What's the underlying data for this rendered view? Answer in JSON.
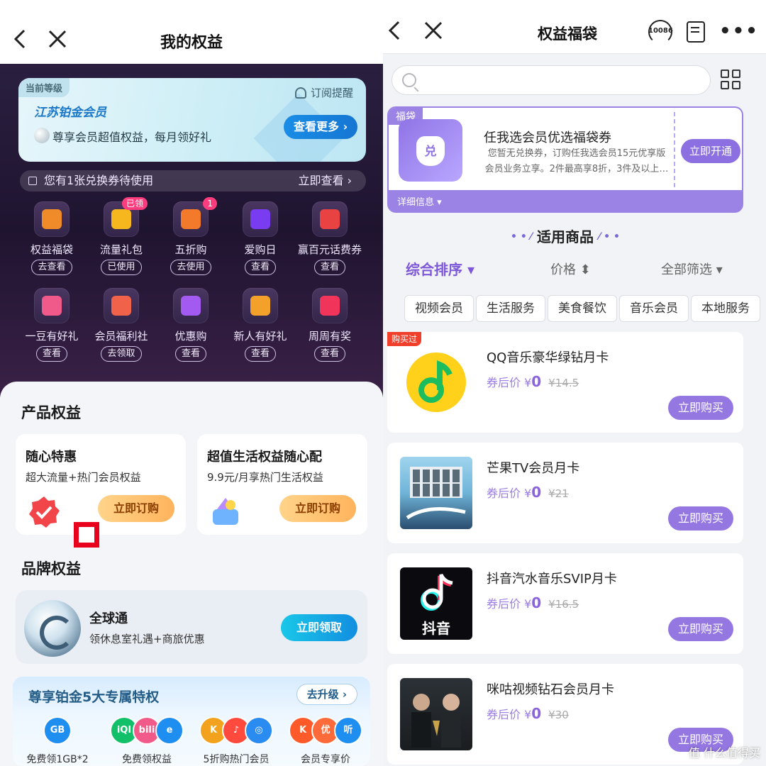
{
  "left": {
    "title": "我的权益",
    "member": {
      "level_tag": "当前等级",
      "subscribe": "订阅提醒",
      "tier": "江苏铂金会员",
      "desc": "尊享会员超值权益，每月领好礼",
      "more": "查看更多 ›"
    },
    "coupon": {
      "text": "您有1张兑换券待使用",
      "action": "立即查看 ›"
    },
    "grid": [
      {
        "label": "权益福袋",
        "action": "去查看",
        "badge": "",
        "color": "#f08b2a"
      },
      {
        "label": "流量礼包",
        "action": "已使用",
        "badge": "已领",
        "color": "#f6b61e"
      },
      {
        "label": "五折购",
        "action": "去使用",
        "badge": "1",
        "color": "#f27a2a"
      },
      {
        "label": "爱购日",
        "action": "查看",
        "badge": "",
        "color": "#7a3cf0"
      },
      {
        "label": "赢百元话费券",
        "action": "查看",
        "badge": "",
        "color": "#e94242"
      },
      {
        "label": "一豆有好礼",
        "action": "查看",
        "badge": "",
        "color": "#f05a8a"
      },
      {
        "label": "会员福利社",
        "action": "去领取",
        "badge": "",
        "color": "#f0634a"
      },
      {
        "label": "优惠购",
        "action": "查看",
        "badge": "",
        "color": "#a35af0"
      },
      {
        "label": "新人有好礼",
        "action": "查看",
        "badge": "",
        "color": "#f3a12a"
      },
      {
        "label": "周周有奖",
        "action": "查看",
        "badge": "",
        "color": "#f0345a"
      }
    ],
    "product_section": "产品权益",
    "products": [
      {
        "title": "随心特惠",
        "desc": "超大流量+热门会员权益",
        "button": "立即订购"
      },
      {
        "title": "超值生活权益随心配",
        "desc": "9.9元/月享热门生活权益",
        "button": "立即订购"
      }
    ],
    "brand_section": "品牌权益",
    "brand": {
      "name": "全球通",
      "desc": "领休息室礼遇+商旅优惠",
      "button": "立即领取"
    },
    "privilege": {
      "title": "尊享铂金5大专属特权",
      "upgrade": "去升级 ›",
      "items": [
        {
          "label": "免费领1GB*2",
          "icons": [
            "GB"
          ]
        },
        {
          "label": "免费领权益",
          "icons": [
            "iQI",
            "bili",
            "e"
          ]
        },
        {
          "label": "5折购热门会员",
          "icons": [
            "K",
            "♪",
            "◎"
          ]
        },
        {
          "label": "会员专享价",
          "icons": [
            "K",
            "优",
            "听"
          ]
        }
      ]
    }
  },
  "right": {
    "title": "权益福袋",
    "service_label": "10086",
    "more": "•••",
    "bag": {
      "tag": "福袋",
      "icon_text": "兑",
      "title": "任我选会员优选福袋券",
      "desc": "您暂无兑换券，订购任我选会员15元优享版会员业务立享。2件最高享8折，3件及以上…",
      "button": "立即开通",
      "info": "详细信息 ▾"
    },
    "section_title": "适用商品",
    "sorts": {
      "overall": "综合排序 ▾",
      "price": "价格 ⬍",
      "filter": "全部筛选 ▾"
    },
    "chips": [
      "视频会员",
      "生活服务",
      "美食餐饮",
      "音乐会员",
      "本地服务"
    ],
    "goods": [
      {
        "name": "QQ音乐豪华绿钻月卡",
        "prefix": "券后价 ¥",
        "price": "0",
        "original": "¥14.5",
        "button": "立即购买",
        "bought": "购买过",
        "logo": "qq"
      },
      {
        "name": "芒果TV会员月卡",
        "prefix": "券后价 ¥",
        "price": "0",
        "original": "¥21",
        "button": "立即购买",
        "bought": "",
        "logo": "mango"
      },
      {
        "name": "抖音汽水音乐SVIP月卡",
        "prefix": "券后价 ¥",
        "price": "0",
        "original": "¥16.5",
        "button": "立即购买",
        "bought": "",
        "logo": "douyin",
        "logo_text": "抖音"
      },
      {
        "name": "咪咕视频钻石会员月卡",
        "prefix": "券后价 ¥",
        "price": "0",
        "original": "¥30",
        "button": "立即购买",
        "bought": "",
        "logo": "migu"
      }
    ],
    "watermark": "值 什么值得买"
  }
}
